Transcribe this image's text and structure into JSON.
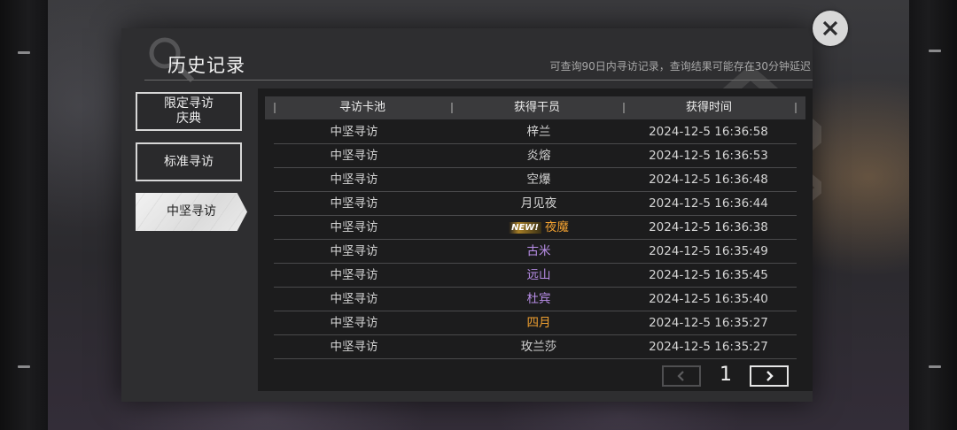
{
  "header": {
    "title": "历史记录",
    "subtitle": "可查询90日内寻访记录，查询结果可能存在30分钟延迟"
  },
  "nav": {
    "items": [
      {
        "label_line1": "限定寻访",
        "label_line2": "庆典",
        "active": false
      },
      {
        "label": "标准寻访",
        "active": false
      },
      {
        "label": "中坚寻访",
        "active": true
      }
    ]
  },
  "table": {
    "headers": [
      "寻访卡池",
      "获得干员",
      "获得时间"
    ],
    "new_badge": "NEW!",
    "rows": [
      {
        "pool": "中坚寻访",
        "operator": "梓兰",
        "time": "2024-12-5 16:36:58",
        "color": "#d4d4d4",
        "is_new": false
      },
      {
        "pool": "中坚寻访",
        "operator": "炎熔",
        "time": "2024-12-5 16:36:53",
        "color": "#d4d4d4",
        "is_new": false
      },
      {
        "pool": "中坚寻访",
        "operator": "空爆",
        "time": "2024-12-5 16:36:48",
        "color": "#d4d4d4",
        "is_new": false
      },
      {
        "pool": "中坚寻访",
        "operator": "月见夜",
        "time": "2024-12-5 16:36:44",
        "color": "#d4d4d4",
        "is_new": false
      },
      {
        "pool": "中坚寻访",
        "operator": "夜魔",
        "time": "2024-12-5 16:36:38",
        "color": "#f0a030",
        "is_new": true
      },
      {
        "pool": "中坚寻访",
        "operator": "古米",
        "time": "2024-12-5 16:35:49",
        "color": "#b98ee8",
        "is_new": false
      },
      {
        "pool": "中坚寻访",
        "operator": "远山",
        "time": "2024-12-5 16:35:45",
        "color": "#b98ee8",
        "is_new": false
      },
      {
        "pool": "中坚寻访",
        "operator": "杜宾",
        "time": "2024-12-5 16:35:40",
        "color": "#b98ee8",
        "is_new": false
      },
      {
        "pool": "中坚寻访",
        "operator": "四月",
        "time": "2024-12-5 16:35:27",
        "color": "#f0a030",
        "is_new": false
      },
      {
        "pool": "中坚寻访",
        "operator": "玫兰莎",
        "time": "2024-12-5 16:35:27",
        "color": "#d4d4d4",
        "is_new": false
      }
    ]
  },
  "pager": {
    "page": "1"
  },
  "icons": {
    "close": "close-icon",
    "prev": "chevron-left-icon",
    "next": "chevron-right-icon"
  }
}
